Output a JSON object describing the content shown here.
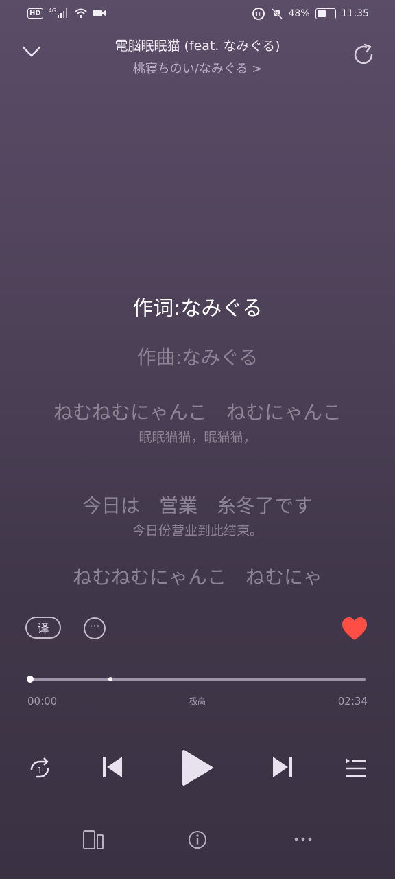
{
  "status_bar": {
    "hd": "HD",
    "network": "4G",
    "battery": "48%",
    "time": "11:35"
  },
  "header": {
    "title": "電脳眠眠猫 (feat. なみぐる)",
    "subtitle": "桃寝ちのい/なみぐる >"
  },
  "lyrics": [
    {
      "text": "作词:なみぐる",
      "active": true
    },
    {
      "text": "作曲:なみぐる",
      "active": false
    },
    {
      "text": "ねむねむにゃんこ　ねむにゃんこ",
      "translation": "眠眠猫猫，眠猫猫，",
      "active": false
    },
    {
      "text": "今日は　営業　糸冬了です",
      "translation": "今日份营业到此结束。",
      "active": false
    },
    {
      "text": "ねむねむにゃんこ　ねむにゃ",
      "active": false
    }
  ],
  "tools": {
    "translate_label": "译",
    "more_label": "···",
    "liked": true
  },
  "progress": {
    "current": "00:00",
    "total": "02:34",
    "quality": "极高",
    "played_fraction": 0.0,
    "buffered_fraction": 0.24
  },
  "player": {
    "repeat_badge": "1"
  },
  "colors": {
    "accent_heart": "#ff4f45",
    "background_top": "#5b4c67",
    "background_bottom": "#3a3243"
  }
}
